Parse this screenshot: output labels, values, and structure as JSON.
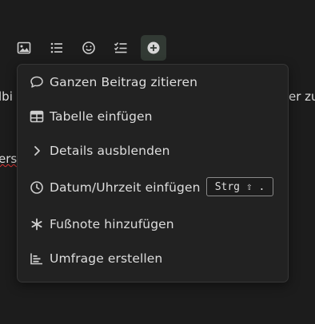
{
  "background_text": {
    "line1_left": "lbi",
    "line1_right": "er zu",
    "line2_left": "ers"
  },
  "toolbar": {
    "buttons": [
      {
        "name": "image-icon"
      },
      {
        "name": "bullet-list-icon"
      },
      {
        "name": "emoji-icon"
      },
      {
        "name": "checklist-icon"
      },
      {
        "name": "plus-circle-icon",
        "active": true
      }
    ]
  },
  "menu": {
    "items": [
      {
        "label": "Ganzen Beitrag zitieren",
        "icon": "speech-bubble-icon"
      },
      {
        "label": "Tabelle einfügen",
        "icon": "table-icon"
      },
      {
        "label": "Details ausblenden",
        "icon": "chevron-right-icon"
      },
      {
        "label": "Datum/Uhrzeit einfügen",
        "icon": "clock-icon",
        "shortcut": "Strg ⇧ ."
      },
      {
        "label": "Fußnote hinzufügen",
        "icon": "asterisk-icon"
      },
      {
        "label": "Umfrage erstellen",
        "icon": "bar-chart-icon"
      }
    ]
  },
  "colors": {
    "background": "#1c1c1c",
    "menu_background": "#222222",
    "text": "#dedede",
    "active_button": "#323a34",
    "spellcheck": "#dd3333"
  }
}
